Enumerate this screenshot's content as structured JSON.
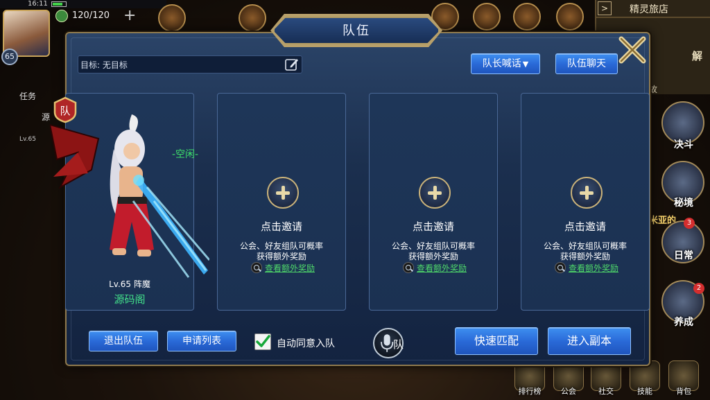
{
  "hud": {
    "time": "16:11",
    "level": "65",
    "stamina": "120/120",
    "right_panel_title": "精灵旅店",
    "right_panel_fragment_1": "解",
    "right_panel_fragment_2": "故",
    "left_task_fragment": "任务",
    "left_name_fragment": "源",
    "left_level_fragment": "Lv.65",
    "gold_text": "米亚的",
    "side_buttons": [
      {
        "label": "决斗",
        "badge": ""
      },
      {
        "label": "秘境",
        "badge": ""
      },
      {
        "label": "日常",
        "badge": "3"
      },
      {
        "label": "养成",
        "badge": "2"
      }
    ],
    "bottom_bar": [
      {
        "label": "排行榜"
      },
      {
        "label": "公会"
      },
      {
        "label": "社交"
      },
      {
        "label": "技能"
      },
      {
        "label": "背包"
      }
    ]
  },
  "modal": {
    "title": "队伍",
    "target_text": "目标: 无目标",
    "leader_shout_label": "队长喊话",
    "team_chat_label": "队伍聊天",
    "leader_badge_text": "队",
    "status_text": "-空闲-",
    "member": {
      "level_text": "Lv.65 阵魔",
      "name": "源码阁"
    },
    "empty_slots": [
      {
        "title": "点击邀请",
        "desc_line1": "公会、好友组队可概率",
        "desc_line2": "获得额外奖励",
        "link": "查看额外奖励"
      },
      {
        "title": "点击邀请",
        "desc_line1": "公会、好友组队可概率",
        "desc_line2": "获得额外奖励",
        "link": "查看额外奖励"
      },
      {
        "title": "点击邀请",
        "desc_line1": "公会、好友组队可概率",
        "desc_line2": "获得额外奖励",
        "link": "查看额外奖励"
      }
    ],
    "leave_team_label": "退出队伍",
    "apply_list_label": "申请列表",
    "auto_accept_label": "自动同意入队",
    "auto_accept_checked": true,
    "voice_label": "队",
    "quick_match_label": "快速匹配",
    "enter_dungeon_label": "进入副本"
  },
  "colors": {
    "panel_bg": "#1b3152",
    "button_blue": "#2a6ad8",
    "accent_gold": "#b8a06a",
    "status_green": "#3ee06a",
    "link_green": "#4fd86a"
  }
}
